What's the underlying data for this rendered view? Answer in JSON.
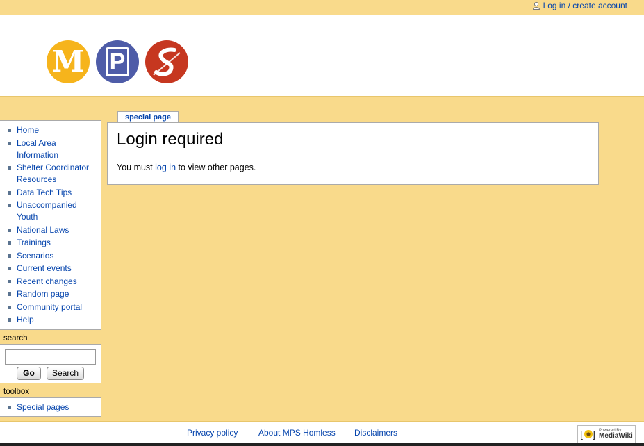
{
  "personal": {
    "login_link": "Log in / create account",
    "icon": "user-icon"
  },
  "header": {
    "logo_letters": [
      "M",
      "P",
      "S"
    ],
    "logo_colors": [
      "#f6b41c",
      "#4e5ca8",
      "#c63720"
    ]
  },
  "content": {
    "tab_label": "special page",
    "title": "Login required",
    "body_prefix": "You must ",
    "body_link": "log in",
    "body_suffix": " to view other pages."
  },
  "navigation": {
    "items": [
      {
        "label": "Home"
      },
      {
        "label": "Local Area Information"
      },
      {
        "label": "Shelter Coordinator Resources"
      },
      {
        "label": "Data Tech Tips"
      },
      {
        "label": "Unaccompanied Youth"
      },
      {
        "label": "National Laws"
      },
      {
        "label": "Trainings"
      },
      {
        "label": "Scenarios"
      },
      {
        "label": "Current events"
      },
      {
        "label": "Recent changes"
      },
      {
        "label": "Random page"
      },
      {
        "label": "Community portal"
      },
      {
        "label": "Help"
      }
    ]
  },
  "search": {
    "title": "search",
    "input_value": "",
    "go_label": "Go",
    "search_label": "Search"
  },
  "toolbox": {
    "title": "toolbox",
    "items": [
      {
        "label": "Special pages"
      }
    ]
  },
  "footer": {
    "privacy": "Privacy policy",
    "about": "About MPS Homless",
    "disclaimers": "Disclaimers",
    "powered_small": "Powered By",
    "powered_big": "MediaWiki"
  },
  "colors": {
    "background": "#f9da8b",
    "link": "#0645ad",
    "bullet": "#5a7390"
  }
}
